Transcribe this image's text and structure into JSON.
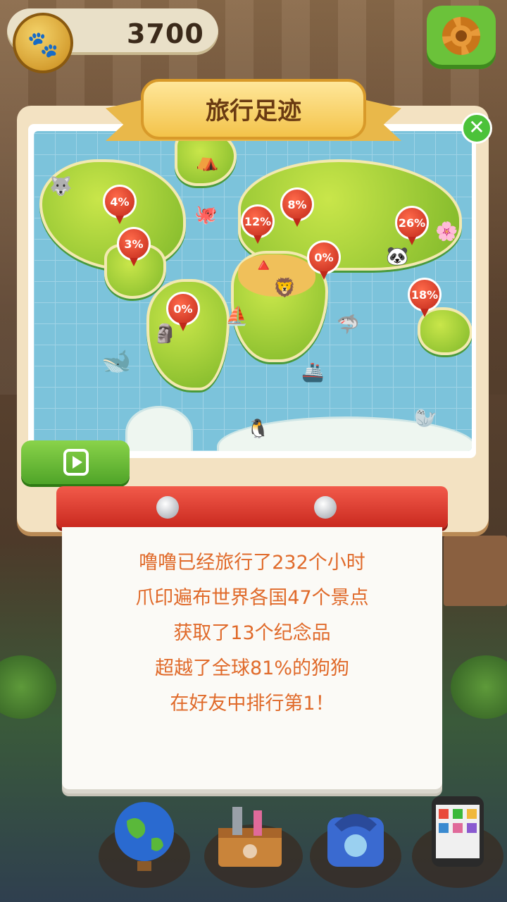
{
  "hud": {
    "coins": "3700",
    "coin_icon": "paw-coin-icon",
    "settings_icon": "gear-icon"
  },
  "panel": {
    "title": "旅行足迹",
    "map_pins": [
      {
        "label": "4%",
        "region": "north-america"
      },
      {
        "label": "3%",
        "region": "central-america"
      },
      {
        "label": "0%",
        "region": "south-america"
      },
      {
        "label": "12%",
        "region": "europe"
      },
      {
        "label": "8%",
        "region": "russia"
      },
      {
        "label": "0%",
        "region": "middle-east"
      },
      {
        "label": "26%",
        "region": "east-asia"
      },
      {
        "label": "18%",
        "region": "southeast-asia"
      }
    ],
    "stats": [
      "噜噜已经旅行了232个小时",
      "爪印遍布世界各国47个景点",
      "获取了13个纪念品",
      "超越了全球81%的狗狗",
      "在好友中排行第1！"
    ]
  },
  "dock": [
    "globe-icon",
    "toolbox-icon",
    "telephone-icon",
    "phone-icon"
  ],
  "colors": {
    "accent": "#e06a2a",
    "green": "#4fa428",
    "red": "#c8281e"
  }
}
